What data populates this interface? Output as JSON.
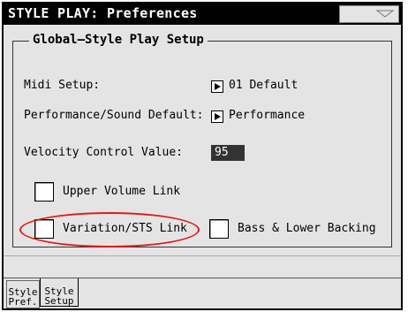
{
  "window": {
    "title": "STYLE PLAY: Preferences"
  },
  "group": {
    "title": "Global–Style Play Setup",
    "midi_setup": {
      "label": "Midi Setup:",
      "value": "01 Default"
    },
    "performance_default": {
      "label": "Performance/Sound Default:",
      "value": "Performance"
    },
    "velocity": {
      "label": "Velocity Control Value:",
      "value": "95"
    },
    "upper_volume_link": {
      "label": "Upper Volume Link",
      "checked": false
    },
    "variation_sts_link": {
      "label": "Variation/STS Link",
      "checked": false
    },
    "bass_lower_backing": {
      "label": "Bass & Lower Backing",
      "checked": false
    }
  },
  "tabs": [
    {
      "line1": "Style",
      "line2": "Pref.",
      "active": false
    },
    {
      "line1": "Style",
      "line2": "Setup",
      "active": true
    }
  ],
  "colors": {
    "title_bar": "#000000",
    "panel": "#e4e4e4",
    "annotation": "#e21a1a"
  }
}
